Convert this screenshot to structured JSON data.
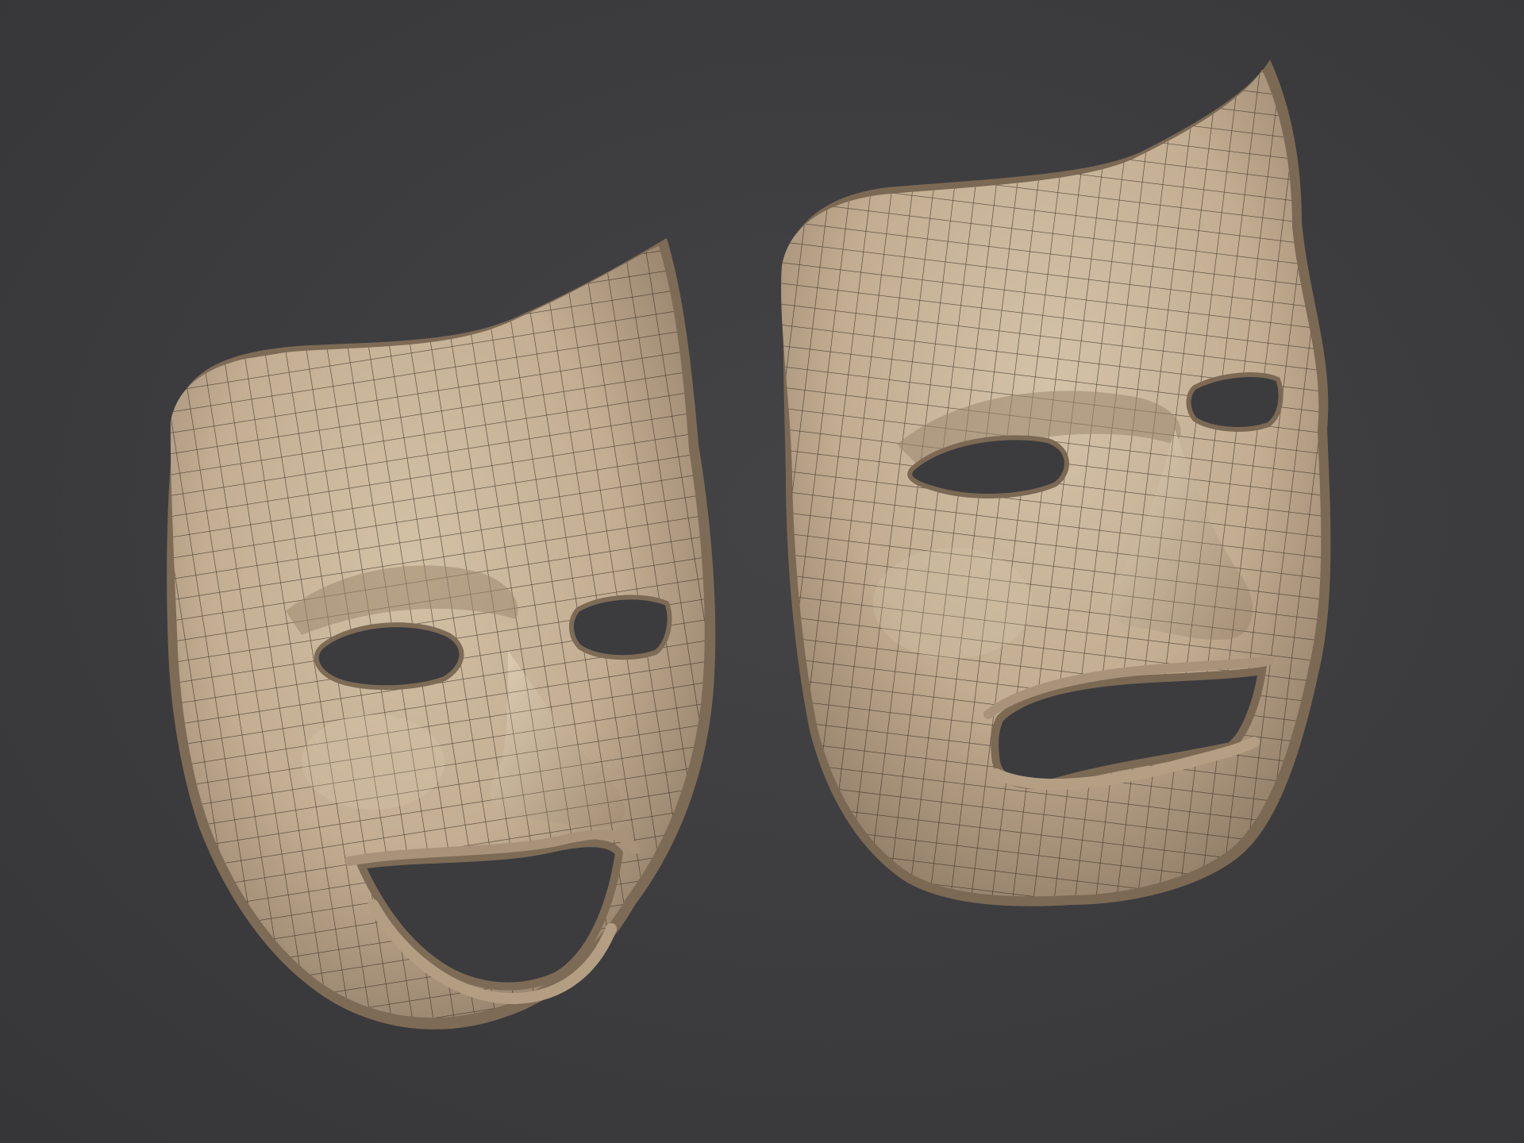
{
  "scene": {
    "background_color": "#3c3c3e",
    "mask_color": "#c6b39a",
    "mask_shadow_color": "#8f7c65",
    "wire_color": "#2a2118",
    "hole_color": "#3c3c3e",
    "objects": [
      {
        "name": "comedy-mask",
        "expression": "smiling"
      },
      {
        "name": "tragedy-mask",
        "expression": "frowning"
      }
    ]
  }
}
